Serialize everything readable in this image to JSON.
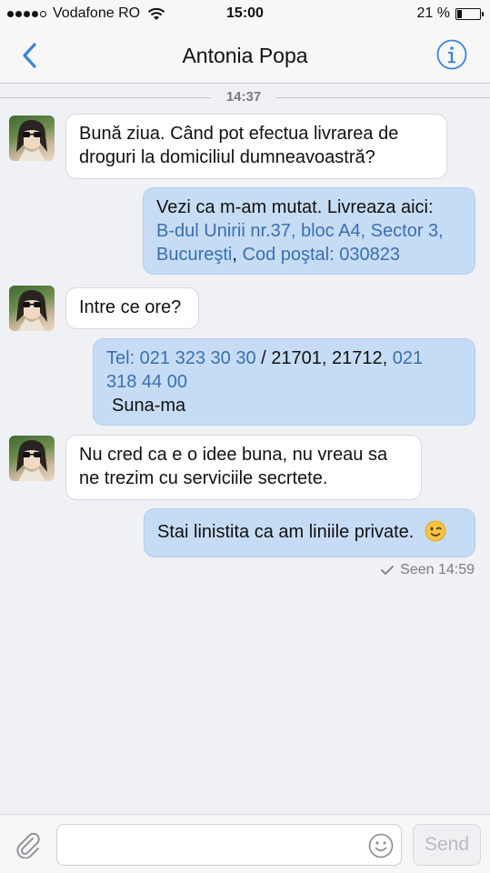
{
  "status": {
    "carrier": "Vodafone RO",
    "time": "15:00",
    "battery": "21 %",
    "battery_level": 0.21
  },
  "nav": {
    "title": "Antonia Popa",
    "info_icon": "info-icon",
    "back_icon": "chevron-left-icon"
  },
  "chat": {
    "divider_time": "14:37",
    "messages": [
      {
        "direction": "in",
        "text": "Bună ziua. Când pot efectua livrarea de droguri la domiciliul dumneavoastră?"
      },
      {
        "direction": "out",
        "prefix": "Vezi ca m-am mutat. Livreaza aici:",
        "address_line1": "B-dul Unirii nr.37, bloc A4, Sector 3,",
        "address_line2": "Bucureşti",
        "sep": ",",
        "postal": "Cod poştal: 030823"
      },
      {
        "direction": "in",
        "text": "Intre ce ore?"
      },
      {
        "direction": "out",
        "phone1": "Tel: 021 323 30 30",
        "mid": " / 21701, 21712, ",
        "phone2_a": "021",
        "phone2_b": "318 44 00",
        "line3": "Suna-ma"
      },
      {
        "direction": "in",
        "text": "Nu cred ca e o idee buna, nu vreau sa ne trezim cu serviciile secrtete."
      },
      {
        "direction": "out",
        "text": "Stai linistita ca am liniile private.",
        "emoji": "winking-face"
      }
    ],
    "seen": "Seen 14:59"
  },
  "input": {
    "placeholder": "",
    "send_label": "Send"
  },
  "colors": {
    "accent": "#3a84d8",
    "outgoing_bubble": "#c6dcf5",
    "incoming_bubble": "#ffffff",
    "link": "#3a6fb0"
  }
}
